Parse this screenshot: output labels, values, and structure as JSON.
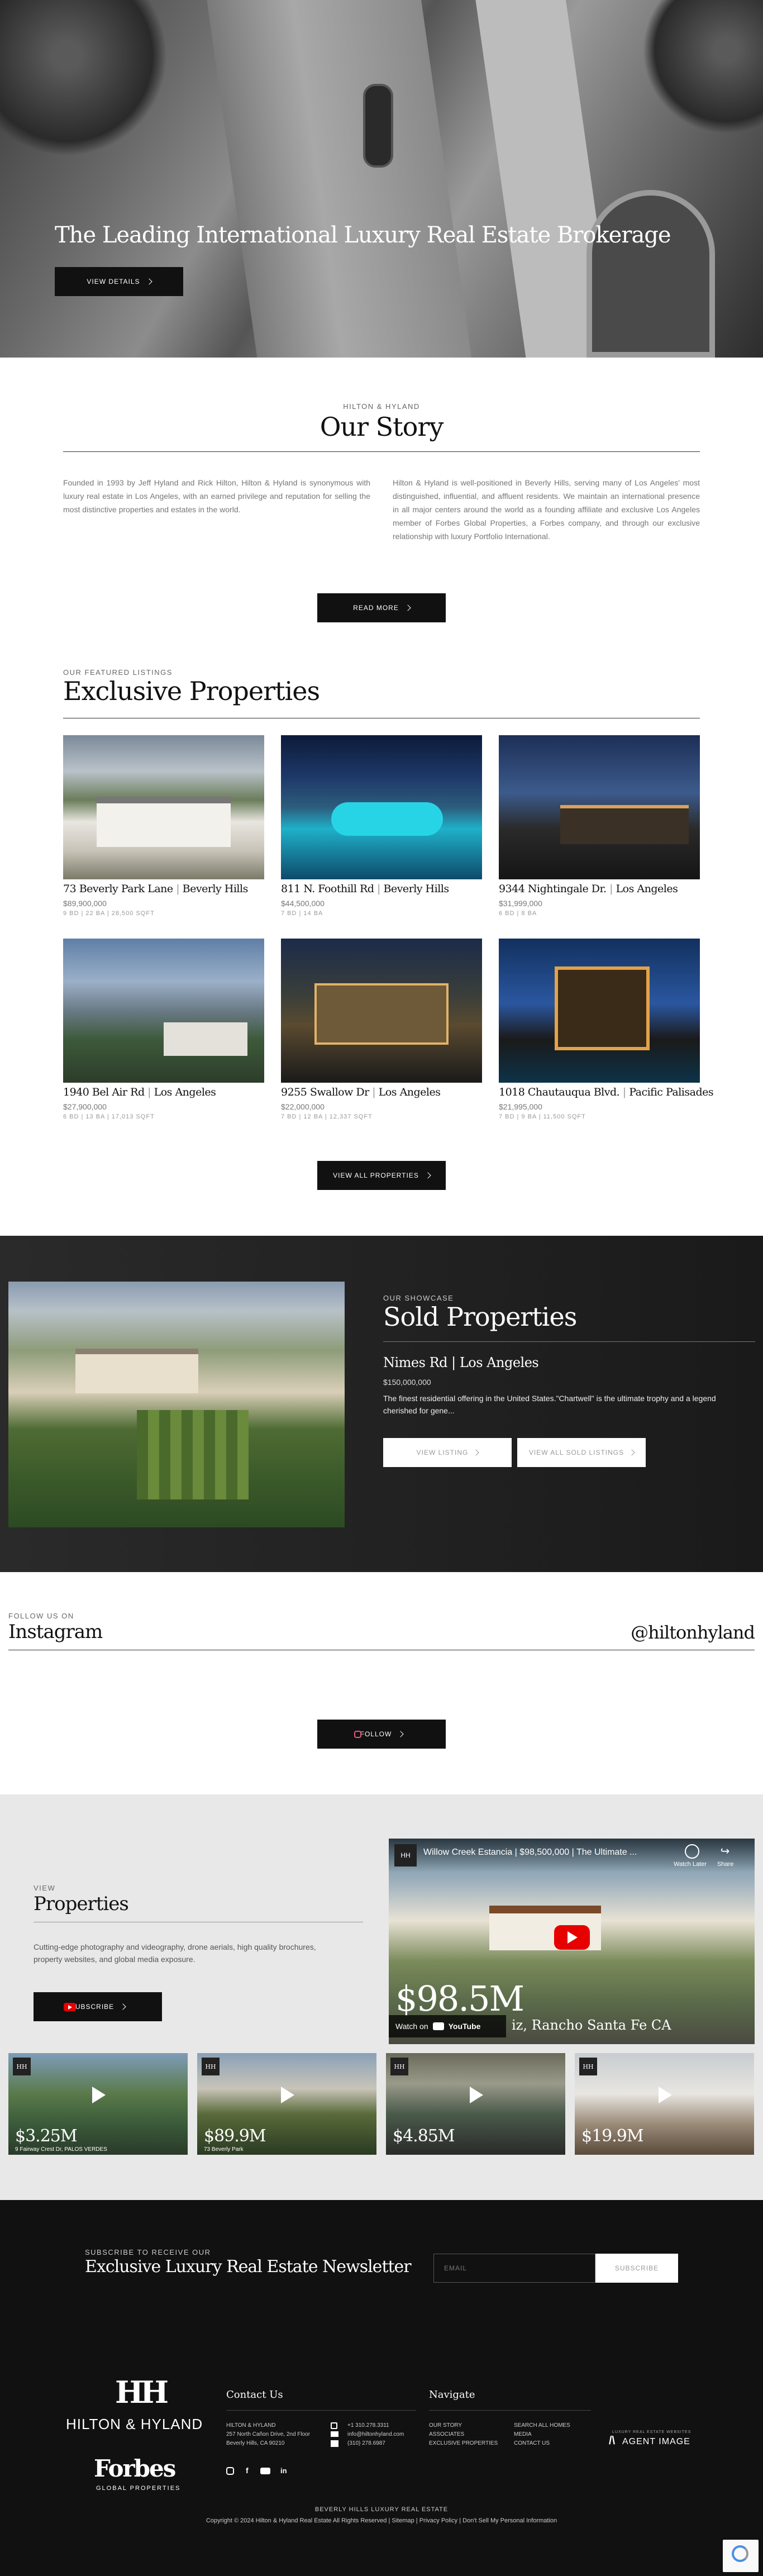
{
  "hero": {
    "title": "The Leading International Luxury Real Estate Brokerage",
    "button_label": "VIEW DETAILS"
  },
  "story": {
    "eyebrow": "HILTON & HYLAND",
    "title": "Our Story",
    "left_text": "Founded in 1993 by Jeff Hyland and Rick Hilton, Hilton & Hyland is synonymous with luxury real estate in Los Angeles, with an earned privilege and reputation for selling the most distinctive properties and estates in the world.",
    "right_text": "Hilton & Hyland is well-positioned in Beverly Hills, serving many of Los Angeles' most distinguished, influential, and affluent residents. We maintain an international presence in all major centers around the world as a founding affiliate and exclusive Los Angeles member of Forbes Global Properties, a Forbes company, and through our exclusive relationship with luxury Portfolio International.",
    "button_label": "READ MORE"
  },
  "featured": {
    "eyebrow": "OUR FEATURED LISTINGS",
    "title": "Exclusive Properties",
    "button_label": "VIEW ALL PROPERTIES",
    "listings": [
      {
        "address": "73 Beverly Park Lane",
        "city": "Beverly Hills",
        "price": "$89,900,000",
        "meta": "9 BD | 22 BA | 28,500 SQFT"
      },
      {
        "address": "811 N. Foothill Rd",
        "city": "Beverly Hills",
        "price": "$44,500,000",
        "meta": "7 BD | 14 BA"
      },
      {
        "address": "9344 Nightingale Dr.",
        "city": "Los Angeles",
        "price": "$31,999,000",
        "meta": "6 BD | 8 BA"
      },
      {
        "address": "1940 Bel Air Rd",
        "city": "Los Angeles",
        "price": "$27,900,000",
        "meta": "6 BD | 13 BA | 17,013 SQFT"
      },
      {
        "address": "9255 Swallow Dr",
        "city": "Los Angeles",
        "price": "$22,000,000",
        "meta": "7 BD | 12 BA | 12,337 SQFT"
      },
      {
        "address": "1018 Chautauqua Blvd.",
        "city": "Pacific Palisades",
        "price": "$21,995,000",
        "meta": "7 BD | 9 BA | 11,500 SQFT"
      }
    ]
  },
  "sold": {
    "eyebrow": "OUR SHOWCASE",
    "title": "Sold Properties",
    "listing_title": "Nimes Rd | Los Angeles",
    "price": "$150,000,000",
    "description": "The finest residential offering in the United States.\"Chartwell\" is the ultimate trophy and a legend cherished for gene...",
    "view_listing_label": "VIEW LISTING",
    "view_all_label": "VIEW ALL SOLD LISTINGS"
  },
  "instagram": {
    "eyebrow": "FOLLOW US ON",
    "title": "Instagram",
    "handle": "@hiltonhyland",
    "button_label": "FOLLOW"
  },
  "videos": {
    "eyebrow": "VIEW",
    "title": "Properties",
    "description": "Cutting-edge photography and videography, drone aerials, high quality brochures, property websites, and global media exposure.",
    "subscribe_label": "SUBSCRIBE",
    "main_video": {
      "title": "Willow Creek Estancia | $98,500,000 | The Ultimate ...",
      "price_overlay": "$98.5M",
      "location_overlay": "iz, Rancho Santa Fe CA",
      "watch_later": "Watch Later",
      "share": "Share",
      "watch_on": "Watch on",
      "youtube": "YouTube"
    },
    "thumbnails": [
      {
        "price": "$3.25M",
        "caption": "9 Fairway Crest Dr, PALOS VERDES"
      },
      {
        "price": "$89.9M",
        "caption": "73 Beverly Park"
      },
      {
        "price": "$4.85M",
        "caption": ""
      },
      {
        "price": "$19.9M",
        "caption": ""
      }
    ]
  },
  "newsletter": {
    "eyebrow": "SUBSCRIBE TO RECEIVE OUR",
    "title": "Exclusive Luxury Real Estate Newsletter",
    "email_placeholder": "EMAIL",
    "button_label": "SUBSCRIBE"
  },
  "footer": {
    "brand": "HILTON & HYLAND",
    "forbes": "Forbes",
    "forbes_sub": "GLOBAL PROPERTIES",
    "contact_heading": "Contact Us",
    "address_lines": [
      "HILTON & HYLAND",
      "257 North Cañon Drive, 2nd Floor",
      "Beverly Hills, CA 90210"
    ],
    "phone": "+1 310.278.3311",
    "email": "info@hiltonhyland.com",
    "fax": "(310) 278.6987",
    "navigate_heading": "Navigate",
    "nav_col1": [
      "OUR STORY",
      "ASSOCIATES",
      "EXCLUSIVE PROPERTIES"
    ],
    "nav_col2": [
      "SEARCH ALL HOMES",
      "MEDIA",
      "CONTACT US"
    ],
    "agent_image": "AGENT IMAGE",
    "agent_image_sub": "LUXURY REAL ESTATE WEBSITES",
    "bottom_line1": "BEVERLY HILLS LUXURY REAL ESTATE",
    "bottom_line2": "Copyright © 2024 Hilton & Hyland Real Estate All Rights Reserved | Sitemap | Privacy Policy | Don't Sell My Personal Information"
  },
  "colors": {
    "dark": "#111111",
    "accent_red": "#e60000",
    "bg_light": "#e8e8e8"
  }
}
